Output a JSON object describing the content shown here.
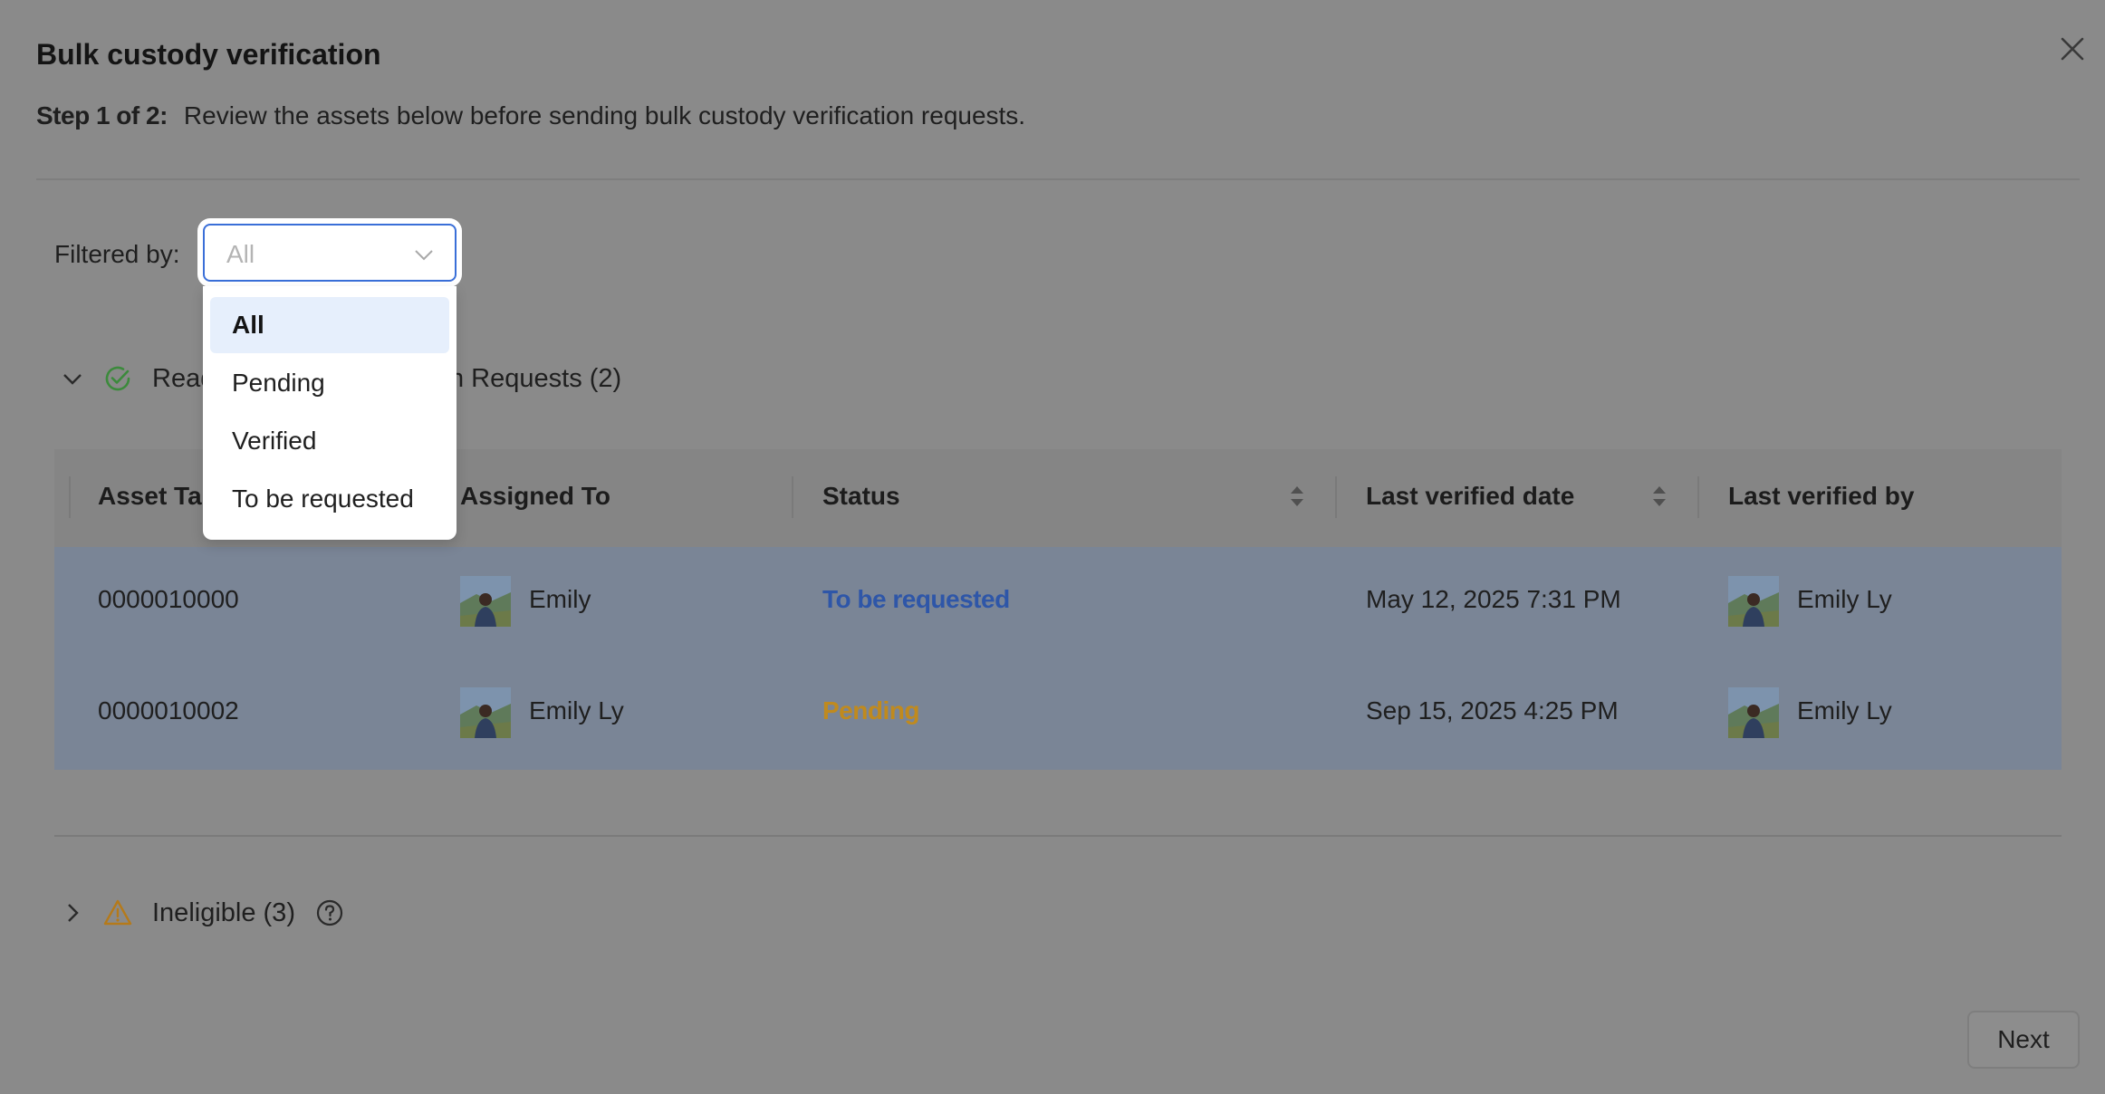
{
  "modal": {
    "title": "Bulk custody verification",
    "step_label": "Step 1 of 2:",
    "step_text": "Review the assets below before sending bulk custody verification requests."
  },
  "filter": {
    "label": "Filtered by:",
    "placeholder": "All",
    "options": [
      {
        "label": "All",
        "selected": true
      },
      {
        "label": "Pending",
        "selected": false
      },
      {
        "label": "Verified",
        "selected": false
      },
      {
        "label": "To be requested",
        "selected": false
      }
    ]
  },
  "groups": {
    "ready": {
      "label_visible_start": "Read",
      "label_visible_end": "n Requests (2)",
      "expanded": true,
      "icon": "check-circle-icon"
    },
    "ineligible": {
      "label": "Ineligible (3)",
      "expanded": false,
      "icon": "warning-icon"
    }
  },
  "table": {
    "columns": [
      "Asset Ta",
      "Assigned To",
      "Status",
      "Last verified date",
      "Last verified by"
    ],
    "rows": [
      {
        "asset_tag": "0000010000",
        "assigned_to": "Emily",
        "status": "To be requested",
        "last_verified_date": "May 12, 2025 7:31 PM",
        "last_verified_by": "Emily Ly"
      },
      {
        "asset_tag": "0000010002",
        "assigned_to": "Emily Ly",
        "status": "Pending",
        "last_verified_date": "Sep 15, 2025 4:25 PM",
        "last_verified_by": "Emily Ly"
      }
    ]
  },
  "footer": {
    "next_label": "Next"
  },
  "colors": {
    "overlay": "#8a8a8a",
    "accent": "#3a6fd8",
    "status_to_be_requested": "#2e56a8",
    "status_pending": "#c08a1e",
    "success": "#3c8a3c",
    "warning": "#b57a1a"
  }
}
